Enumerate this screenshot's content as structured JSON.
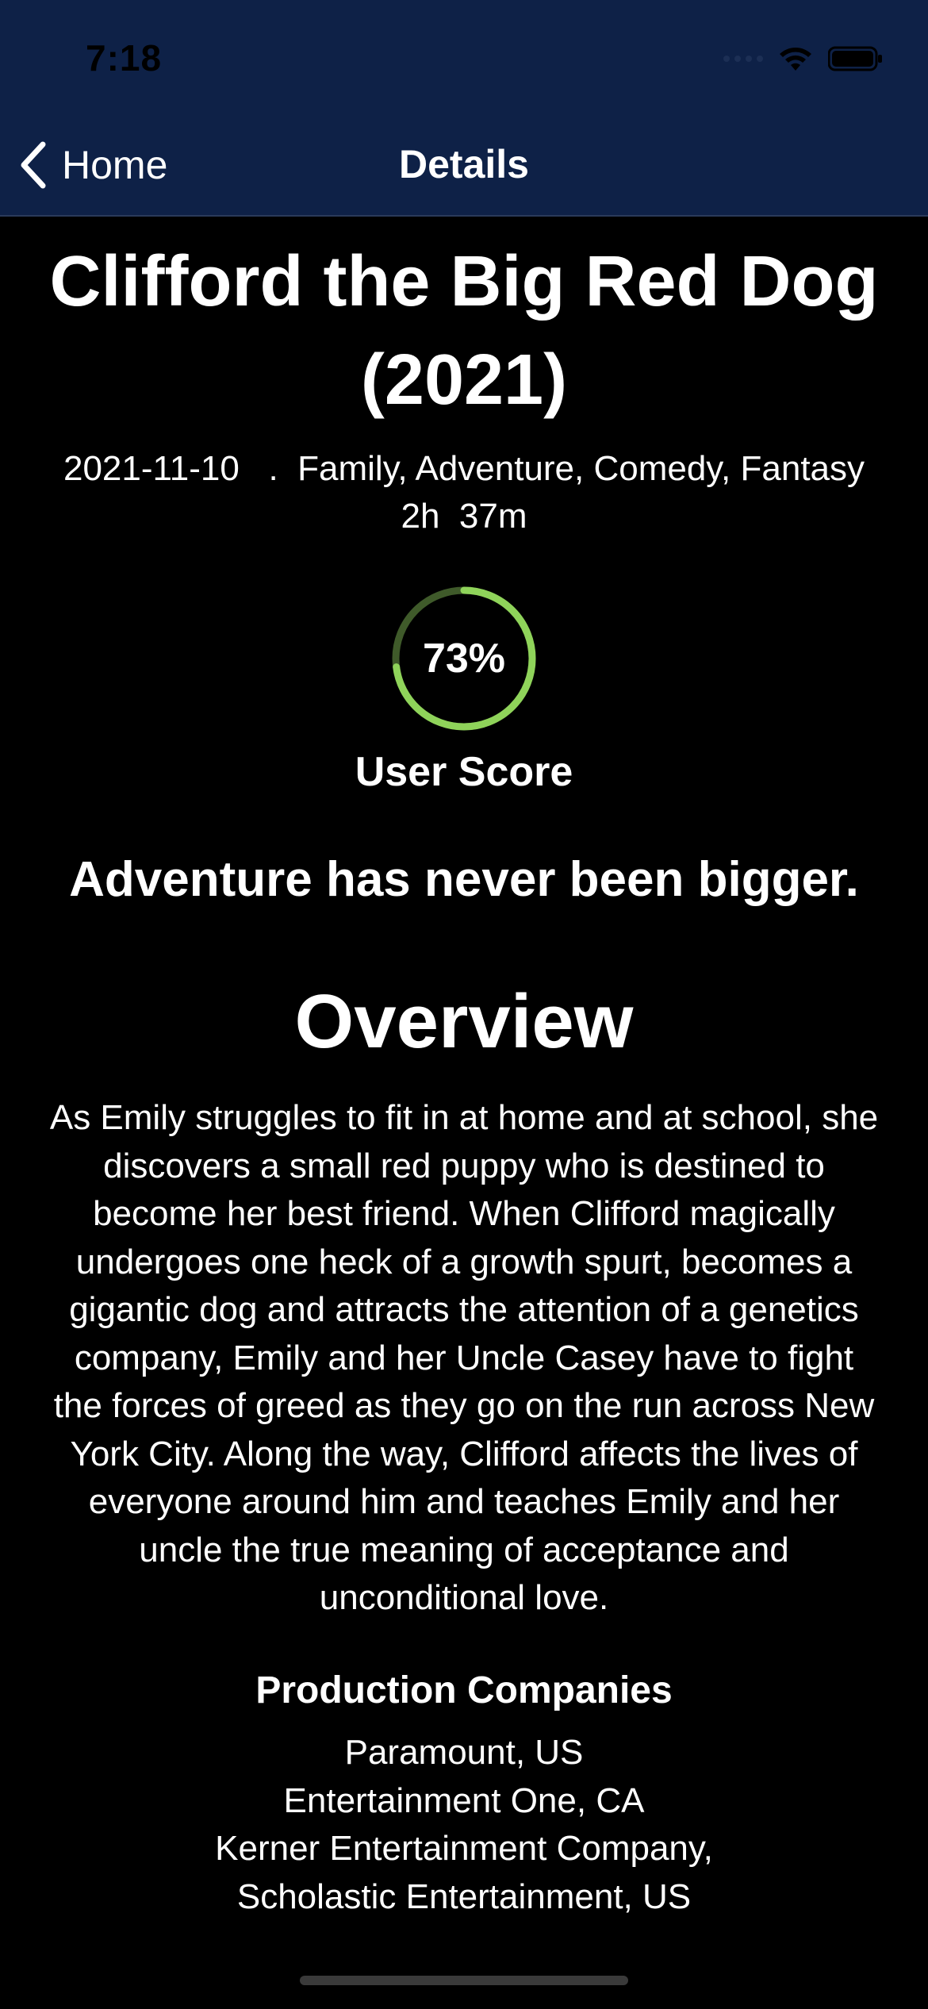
{
  "status_bar": {
    "time": "7:18",
    "icons": [
      "cellular-signal-icon",
      "wifi-icon",
      "battery-icon"
    ]
  },
  "nav": {
    "back_label": "Home",
    "title": "Details"
  },
  "movie": {
    "title": "Clifford the Big Red Dog (2021)",
    "meta_line1": "2021-11-10   .  Family, Adventure, Comedy, Fantasy",
    "meta_line2": "2h  37m",
    "user_score_value": 0.73,
    "user_score_text": "73%",
    "user_score_label": "User Score",
    "tagline": "Adventure has never been bigger.",
    "overview_heading": "Overview",
    "overview": "As Emily struggles to fit in at home and at school, she discovers a small red puppy who is destined to become her best friend. When Clifford magically undergoes one heck of a growth spurt, becomes a gigantic dog and attracts the attention of a genetics company, Emily and her Uncle Casey have to fight the forces of greed as they go on the run across New York City. Along the way, Clifford affects the lives of everyone around him and teaches Emily and her uncle the true meaning of acceptance and unconditional love.",
    "production_heading": "Production Companies",
    "production_companies": "Paramount, US\nEntertainment One, CA\nKerner Entertainment Company,\nScholastic Entertainment, US"
  },
  "colors": {
    "nav_background": "#0e2147",
    "page_background": "#000000",
    "score_ring": "#8fd35a",
    "score_track": "#3f5a2a",
    "text": "#ffffff"
  }
}
